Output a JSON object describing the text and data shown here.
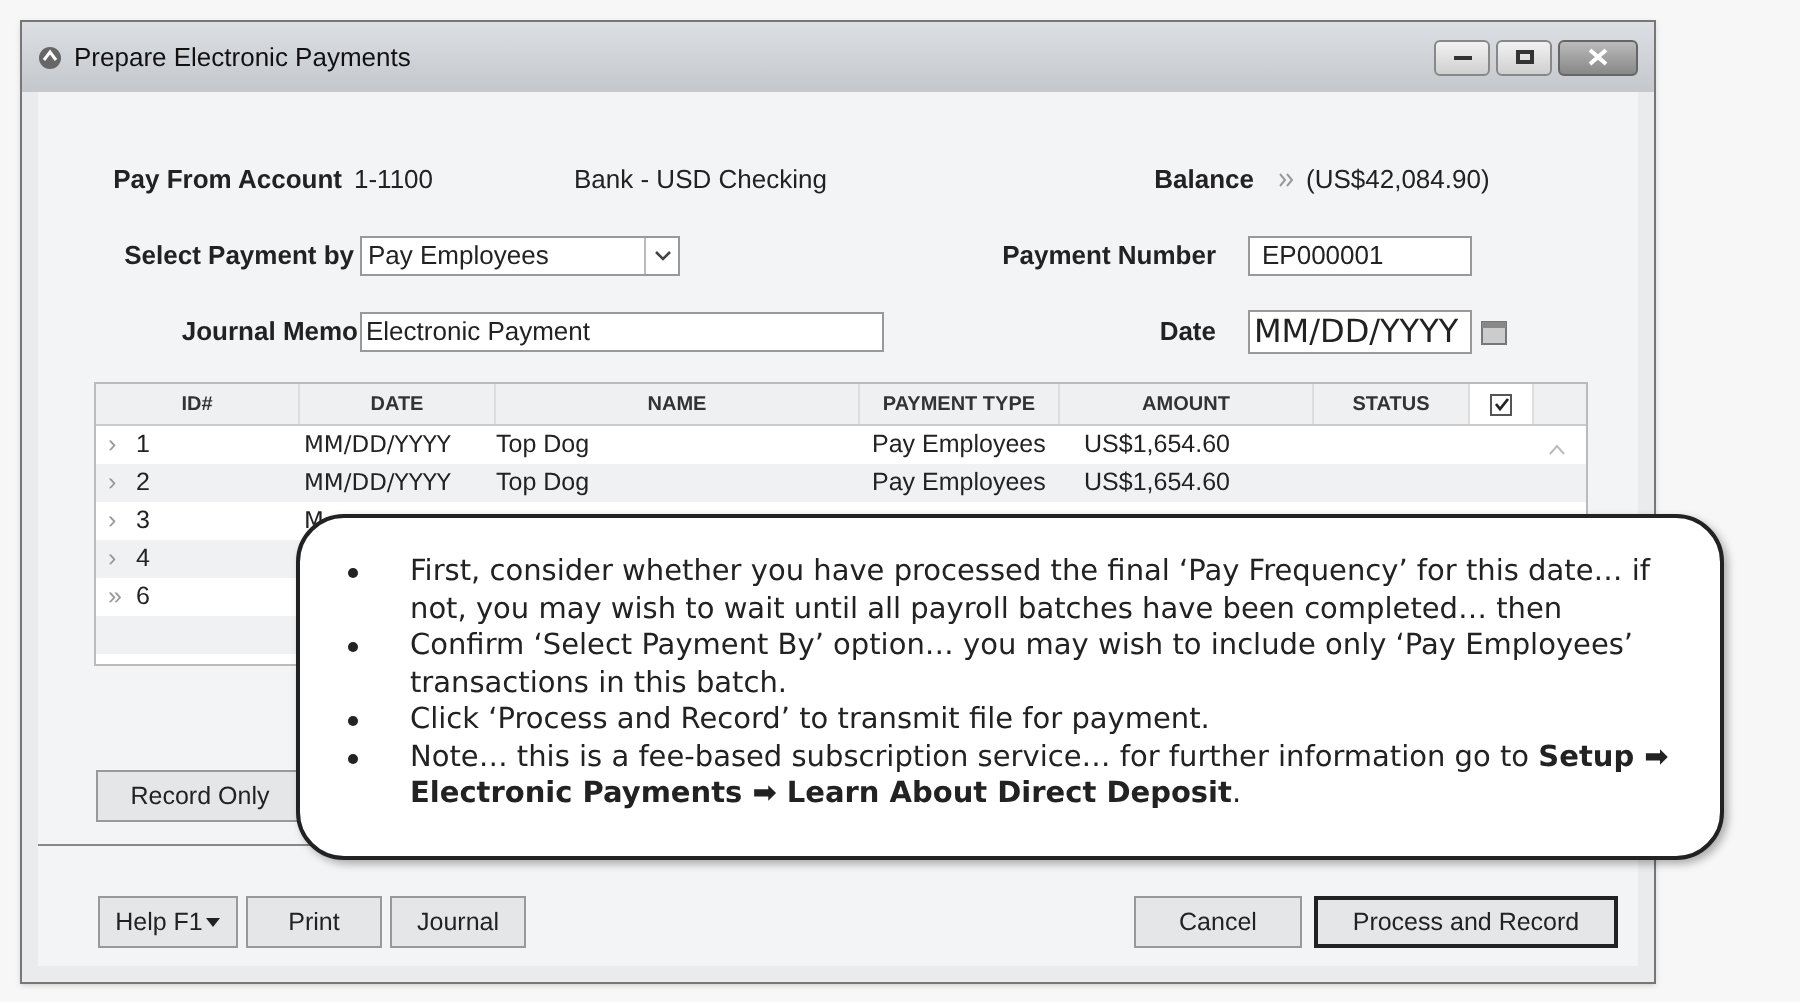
{
  "window": {
    "title": "Prepare Electronic Payments"
  },
  "pay_from_account": {
    "label": "Pay From Account",
    "number": "1-1100",
    "name": "Bank - USD Checking"
  },
  "balance": {
    "label": "Balance",
    "value": "(US$42,084.90)"
  },
  "select_payment_by": {
    "label": "Select Payment by",
    "value": "Pay Employees"
  },
  "payment_number": {
    "label": "Payment Number",
    "value": "EP000001"
  },
  "journal_memo": {
    "label": "Journal Memo",
    "value": "Electronic Payment"
  },
  "date": {
    "label": "Date",
    "value": "MM/DD/YYYY"
  },
  "table": {
    "columns": [
      "ID#",
      "DATE",
      "NAME",
      "PAYMENT TYPE",
      "AMOUNT",
      "STATUS"
    ],
    "select_all_checked": true,
    "rows": [
      {
        "marker": "›",
        "id": "1",
        "date": "MM/DD/YYYY",
        "name": "Top Dog",
        "payment_type": "Pay Employees",
        "amount": "US$1,654.60"
      },
      {
        "marker": "›",
        "id": "2",
        "date": "MM/DD/YYYY",
        "name": "Top Dog",
        "payment_type": "Pay Employees",
        "amount": "US$1,654.60"
      },
      {
        "marker": "›",
        "id": "3",
        "date": "M"
      },
      {
        "marker": "›",
        "id": "4"
      },
      {
        "marker": "»",
        "id": "6"
      }
    ]
  },
  "record_only_button": "Record Only",
  "buttons": [
    {
      "label": "Help F1",
      "kind": "dropdown",
      "default": false
    },
    {
      "label": "Print",
      "kind": "plain",
      "default": false
    },
    {
      "label": "Journal",
      "kind": "plain",
      "default": false
    },
    {
      "label": "Cancel",
      "kind": "plain",
      "default": false
    },
    {
      "label": "Process and Record",
      "kind": "plain",
      "default": true
    }
  ],
  "callout": {
    "items": [
      "First, consider whether you have processed the final ‘Pay Frequency’ for this date… if not, you may wish to wait until all payroll batches have been completed… then",
      "Confirm ‘Select Payment By’ option… you may wish to include only ‘Pay Employees’ transactions in this batch.",
      "Click ‘Process and Record’ to transmit file for payment.",
      "Note… this is a fee-based subscription service… for further information go to **Setup ➡ Electronic Payments ➡ Learn About Direct Deposit**."
    ]
  }
}
